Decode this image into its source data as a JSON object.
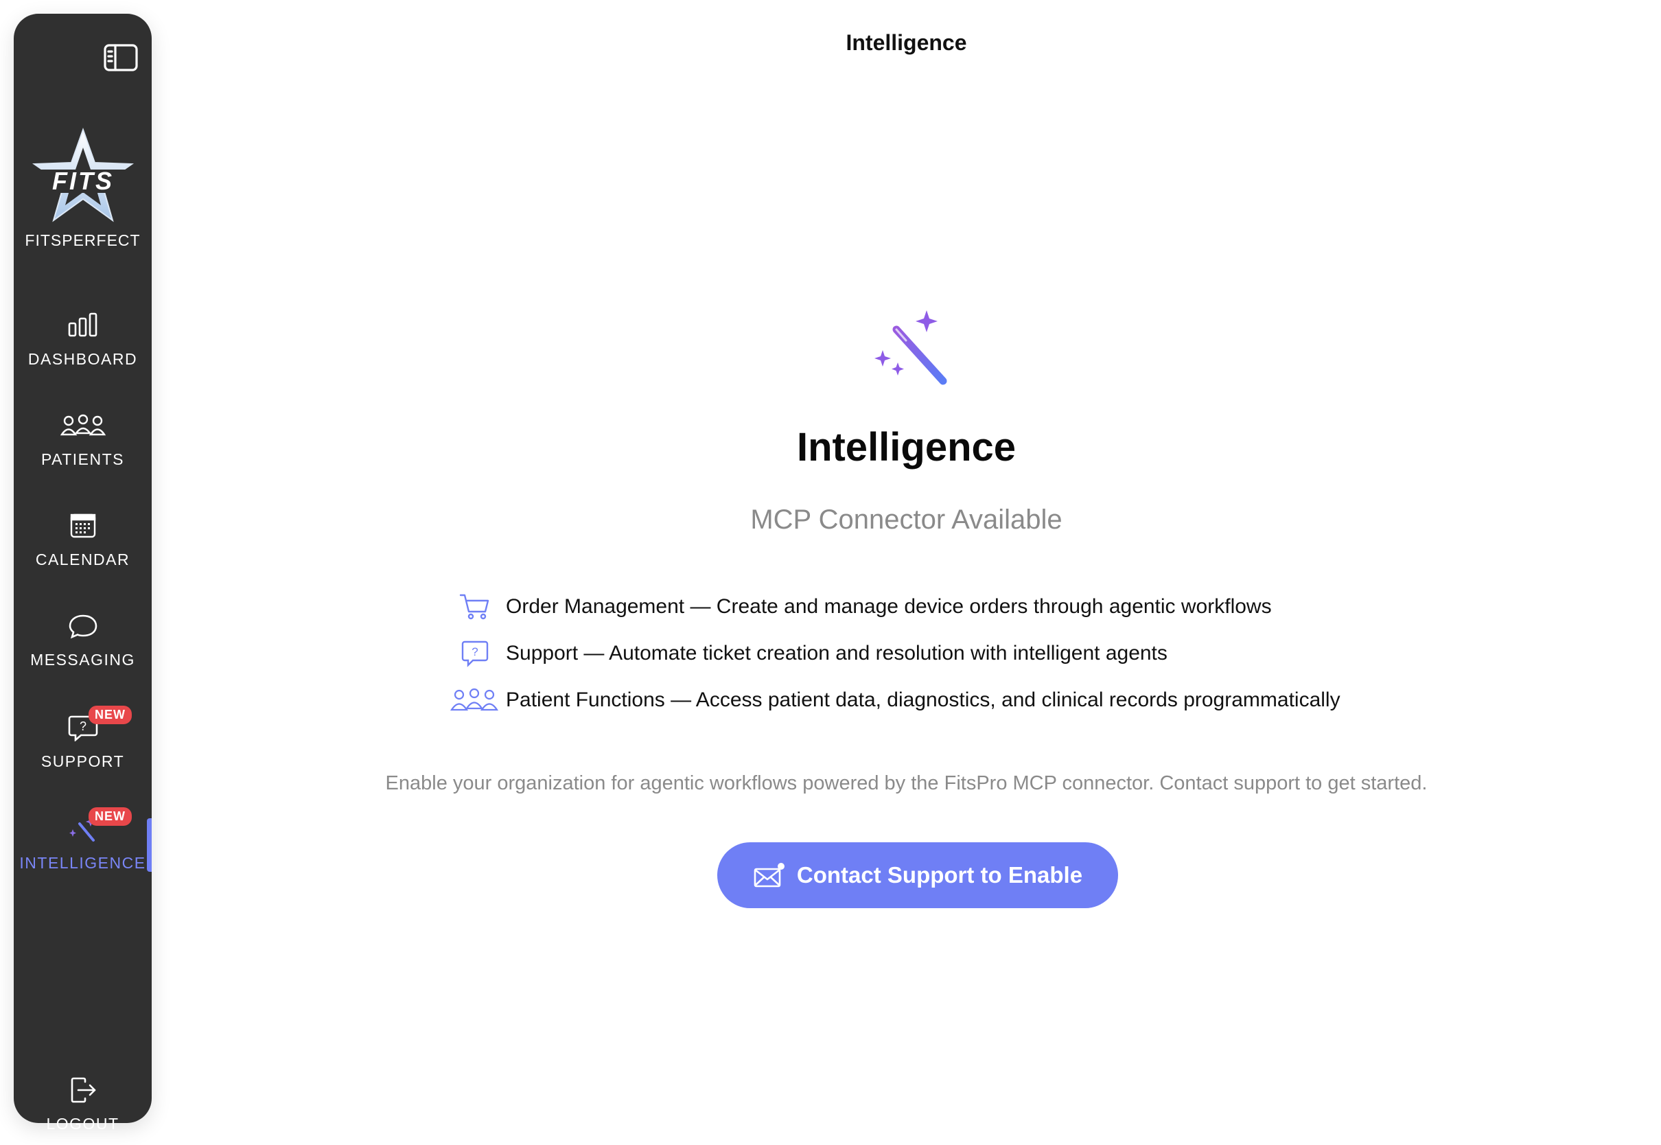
{
  "window": {
    "title": "Intelligence"
  },
  "sidebar": {
    "toggle_icon": "sidebar-toggle-icon",
    "brand": {
      "logo_text": "FITS",
      "name": "FITSPERFECT"
    },
    "items": [
      {
        "id": "dashboard",
        "label": "DASHBOARD",
        "icon": "bar-chart-icon",
        "badge": ""
      },
      {
        "id": "patients",
        "label": "PATIENTS",
        "icon": "people-icon",
        "badge": ""
      },
      {
        "id": "calendar",
        "label": "CALENDAR",
        "icon": "calendar-icon",
        "badge": ""
      },
      {
        "id": "messaging",
        "label": "MESSAGING",
        "icon": "chat-bubble-icon",
        "badge": ""
      },
      {
        "id": "support",
        "label": "SUPPORT",
        "icon": "help-bubble-icon",
        "badge": "NEW"
      },
      {
        "id": "intelligence",
        "label": "INTELLIGENCE",
        "icon": "magic-wand-icon",
        "badge": "NEW",
        "active": true
      }
    ],
    "logout": {
      "label": "LOGOUT",
      "icon": "logout-icon"
    }
  },
  "main": {
    "header_title": "Intelligence",
    "hero": {
      "icon": "magic-wand-sparkles-icon",
      "title": "Intelligence",
      "subtitle": "MCP Connector Available"
    },
    "features": [
      {
        "icon": "cart-icon",
        "text": "Order Management — Create and manage device orders through agentic workflows"
      },
      {
        "icon": "help-bubble-icon",
        "text": "Support — Automate ticket creation and resolution with intelligent agents"
      },
      {
        "icon": "people-icon",
        "text": "Patient Functions — Access patient data, diagnostics, and clinical records programmatically"
      }
    ],
    "description": "Enable your organization for agentic workflows powered by the FitsPro MCP connector. Contact support to get started.",
    "cta": {
      "label": "Contact Support to Enable",
      "icon": "mail-notification-icon"
    }
  },
  "colors": {
    "sidebar_bg": "#303030",
    "accent": "#6f7ff5",
    "active_label": "#7a86f7",
    "badge": "#e8474a",
    "muted_text": "#8a8a8a"
  }
}
